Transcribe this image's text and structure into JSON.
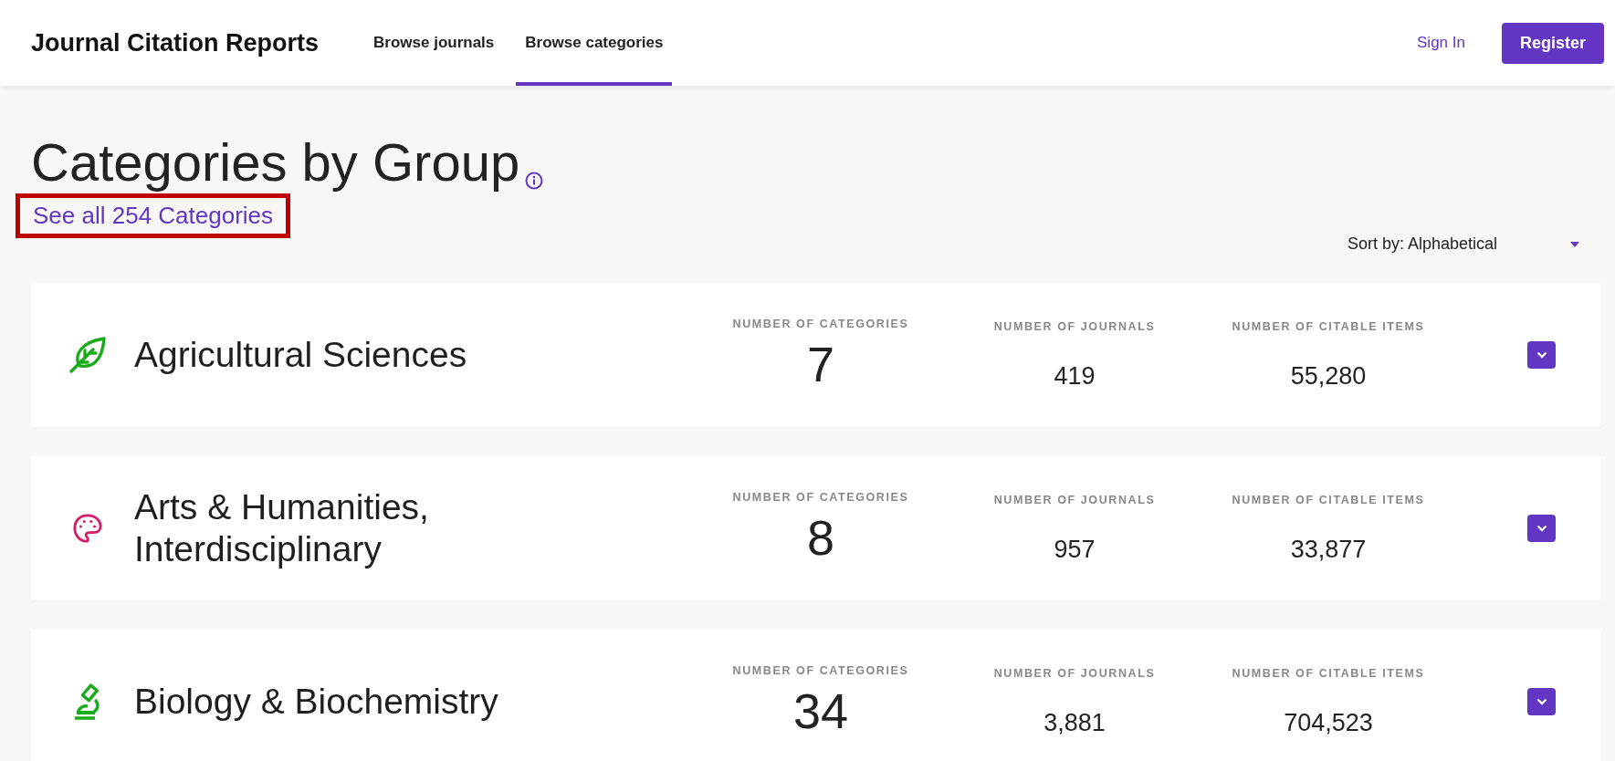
{
  "header": {
    "title": "Journal Citation Reports",
    "nav": [
      {
        "label": "Browse journals",
        "selected": false
      },
      {
        "label": "Browse categories",
        "selected": true
      }
    ],
    "sign_in": "Sign In",
    "register": "Register"
  },
  "page": {
    "title": "Categories by Group",
    "see_all_link": "See all 254 Categories",
    "see_all_highlighted": true,
    "sort": {
      "label": "Sort by: Alphabetical"
    }
  },
  "groups": [
    {
      "name": "Agricultural Sciences",
      "kind": "leaf",
      "color": "#1aab1a",
      "categories_label": "NUMBER OF CATEGORIES",
      "categories": "7",
      "journals_label": "NUMBER OF JOURNALS",
      "journals": "419",
      "citable_label": "NUMBER OF CITABLE ITEMS",
      "citable": "55,280"
    },
    {
      "name": "Arts & Humanities, Interdisciplinary",
      "kind": "palette",
      "color": "#d61a6a",
      "categories_label": "NUMBER OF CATEGORIES",
      "categories": "8",
      "journals_label": "NUMBER OF JOURNALS",
      "journals": "957",
      "citable_label": "NUMBER OF CITABLE ITEMS",
      "citable": "33,877"
    },
    {
      "name": "Biology & Biochemistry",
      "kind": "microscope",
      "color": "#1aab1a",
      "categories_label": "NUMBER OF CATEGORIES",
      "categories": "34",
      "journals_label": "NUMBER OF JOURNALS",
      "journals": "3,881",
      "citable_label": "NUMBER OF CITABLE ITEMS",
      "citable": "704,523"
    }
  ]
}
